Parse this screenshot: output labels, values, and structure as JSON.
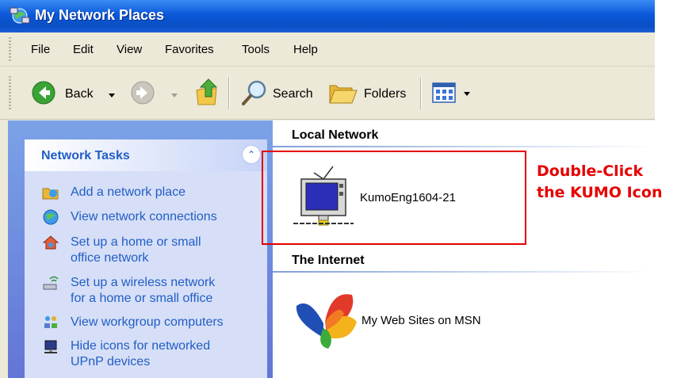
{
  "window": {
    "title": "My Network Places"
  },
  "menu": {
    "items": [
      "File",
      "Edit",
      "View",
      "Favorites",
      "Tools",
      "Help"
    ]
  },
  "toolbar": {
    "back_label": "Back",
    "search_label": "Search",
    "folders_label": "Folders"
  },
  "tasks": {
    "title": "Network Tasks",
    "items": [
      {
        "line1": "Add a network place",
        "line2": ""
      },
      {
        "line1": "View network connections",
        "line2": ""
      },
      {
        "line1": "Set up a home or small",
        "line2": "office network"
      },
      {
        "line1": "Set up a wireless network",
        "line2": "for a home or small office"
      },
      {
        "line1": "View workgroup computers",
        "line2": ""
      },
      {
        "line1": "Hide icons for networked",
        "line2": "UPnP devices"
      }
    ]
  },
  "content": {
    "local_network": {
      "title": "Local Network",
      "item_label": "KumoEng1604-21"
    },
    "internet": {
      "title": "The Internet",
      "item_label": "My Web Sites on MSN"
    }
  },
  "annotation": {
    "line1": "Double-Click",
    "line2": "the KUMO Icon"
  },
  "colors": {
    "titlebar": "#0b58d9",
    "task_link": "#215dc6",
    "callout": "#e60000"
  }
}
